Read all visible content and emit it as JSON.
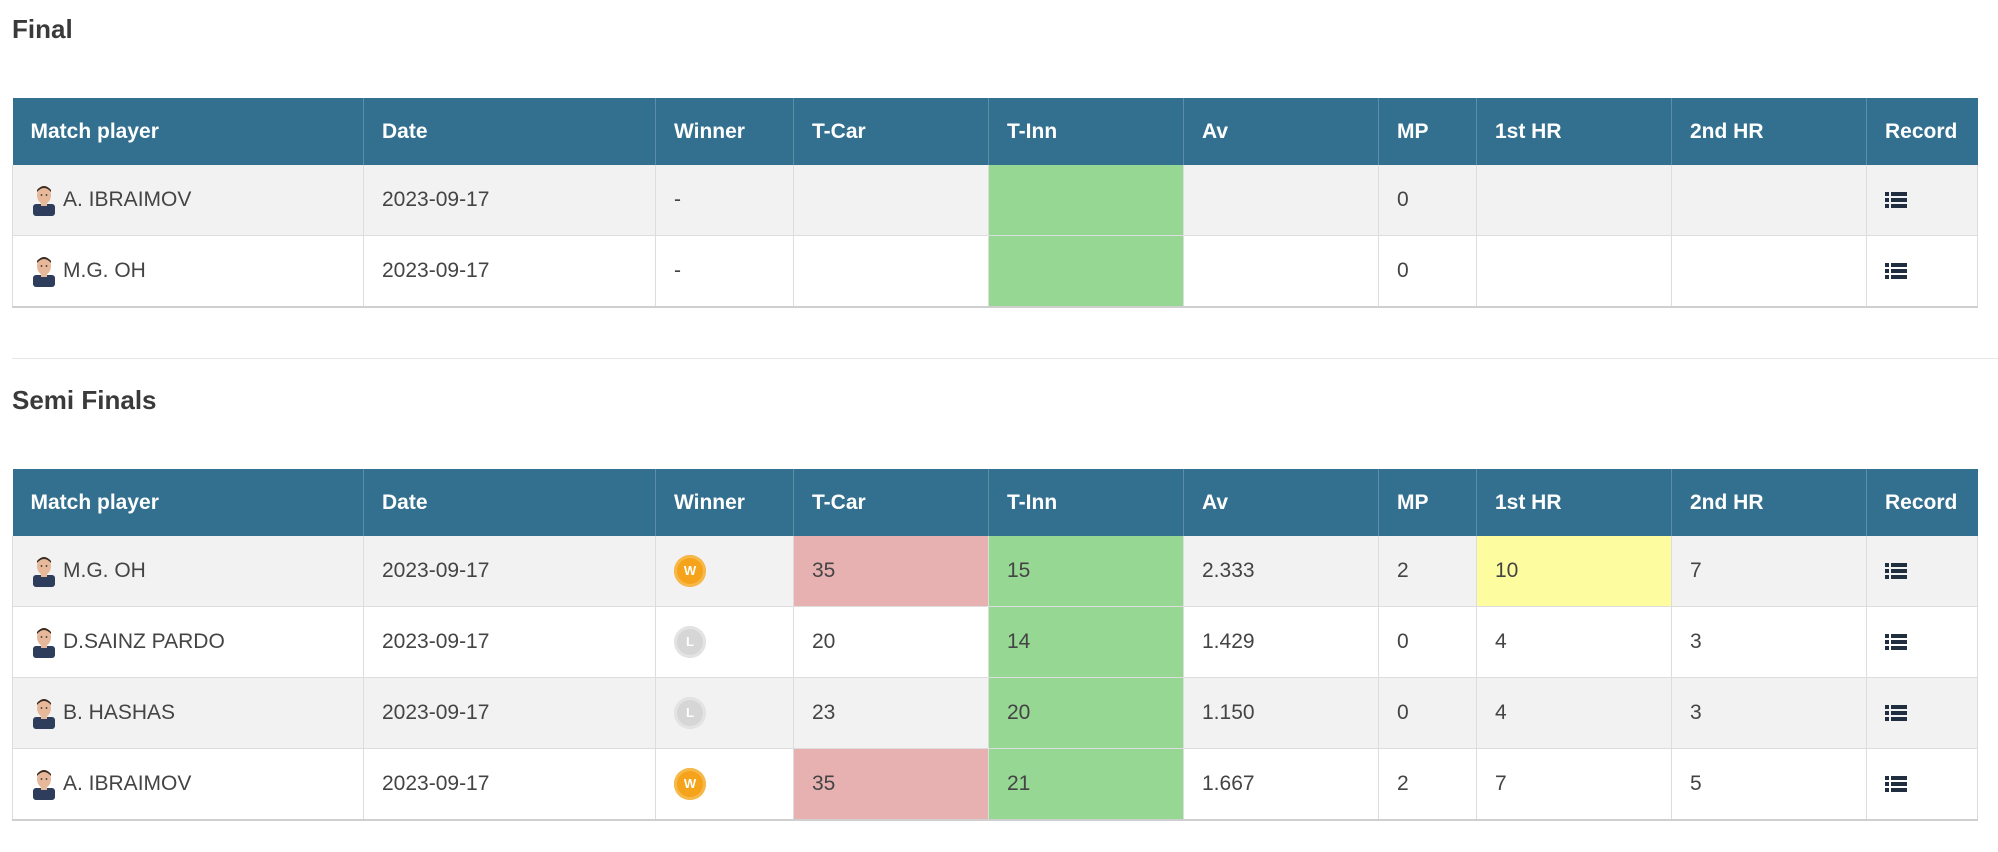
{
  "sections": [
    {
      "title": "Final",
      "headers": [
        "Match player",
        "Date",
        "Winner",
        "T-Car",
        "T-Inn",
        "Av",
        "MP",
        "1st HR",
        "2nd HR",
        "Record"
      ],
      "rows": [
        {
          "player": "A. IBRAIMOV",
          "avatar": "player-photo-icon",
          "date": "2023-09-17",
          "winner": "-",
          "winner_type": "none",
          "tcar": "",
          "tinn": "",
          "av": "",
          "mp": "0",
          "hr1": "",
          "hr2": "",
          "tcar_hl": "",
          "tinn_hl": "green",
          "hr1_hl": ""
        },
        {
          "player": "M.G. OH",
          "avatar": "player-photo-icon",
          "date": "2023-09-17",
          "winner": "-",
          "winner_type": "none",
          "tcar": "",
          "tinn": "",
          "av": "",
          "mp": "0",
          "hr1": "",
          "hr2": "",
          "tcar_hl": "",
          "tinn_hl": "green",
          "hr1_hl": ""
        }
      ]
    },
    {
      "title": "Semi Finals",
      "headers": [
        "Match player",
        "Date",
        "Winner",
        "T-Car",
        "T-Inn",
        "Av",
        "MP",
        "1st HR",
        "2nd HR",
        "Record"
      ],
      "rows": [
        {
          "player": "M.G. OH",
          "avatar": "player-photo-icon",
          "date": "2023-09-17",
          "winner": "W",
          "winner_type": "win",
          "tcar": "35",
          "tinn": "15",
          "av": "2.333",
          "mp": "2",
          "hr1": "10",
          "hr2": "7",
          "tcar_hl": "red",
          "tinn_hl": "green",
          "hr1_hl": "yellow"
        },
        {
          "player": "D.SAINZ PARDO",
          "avatar": "player-photo-icon",
          "date": "2023-09-17",
          "winner": "L",
          "winner_type": "loss",
          "tcar": "20",
          "tinn": "14",
          "av": "1.429",
          "mp": "0",
          "hr1": "4",
          "hr2": "3",
          "tcar_hl": "",
          "tinn_hl": "green",
          "hr1_hl": ""
        },
        {
          "player": "B. HASHAS",
          "avatar": "player-photo-icon",
          "date": "2023-09-17",
          "winner": "L",
          "winner_type": "loss",
          "tcar": "23",
          "tinn": "20",
          "av": "1.150",
          "mp": "0",
          "hr1": "4",
          "hr2": "3",
          "tcar_hl": "",
          "tinn_hl": "green",
          "hr1_hl": ""
        },
        {
          "player": "A. IBRAIMOV",
          "avatar": "player-photo-icon",
          "date": "2023-09-17",
          "winner": "W",
          "winner_type": "win",
          "tcar": "35",
          "tinn": "21",
          "av": "1.667",
          "mp": "2",
          "hr1": "7",
          "hr2": "5",
          "tcar_hl": "red",
          "tinn_hl": "green",
          "hr1_hl": ""
        }
      ]
    }
  ],
  "record_icon": "list-icon",
  "colors": {
    "header_bg": "#33708f",
    "green": "#95d793",
    "red": "#e8b1b1",
    "yellow": "#fdfc9f",
    "win": "#f5a31a",
    "loss": "#d6d6d6"
  }
}
